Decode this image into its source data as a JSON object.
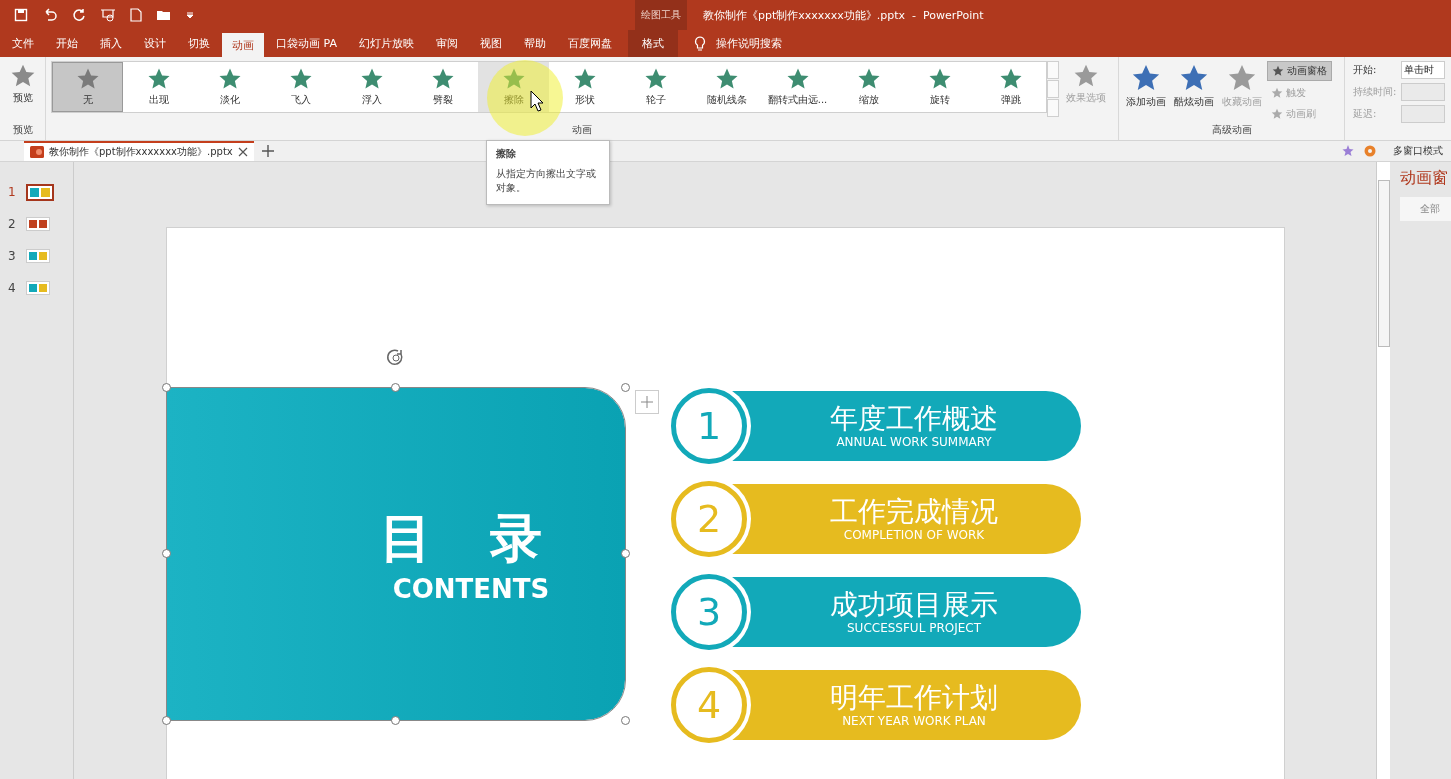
{
  "window": {
    "title": "教你制作《ppt制作xxxxxxx功能》.pptx  -  PowerPoint",
    "contextual_group": "绘图工具"
  },
  "ribbon_tabs": [
    {
      "label": "文件",
      "selected": false,
      "contextual": false
    },
    {
      "label": "开始",
      "selected": false,
      "contextual": false
    },
    {
      "label": "插入",
      "selected": false,
      "contextual": false
    },
    {
      "label": "设计",
      "selected": false,
      "contextual": false
    },
    {
      "label": "切换",
      "selected": false,
      "contextual": false
    },
    {
      "label": "动画",
      "selected": true,
      "contextual": false
    },
    {
      "label": "口袋动画 PA",
      "selected": false,
      "contextual": false
    },
    {
      "label": "幻灯片放映",
      "selected": false,
      "contextual": false
    },
    {
      "label": "审阅",
      "selected": false,
      "contextual": false
    },
    {
      "label": "视图",
      "selected": false,
      "contextual": false
    },
    {
      "label": "帮助",
      "selected": false,
      "contextual": false
    },
    {
      "label": "百度网盘",
      "selected": false,
      "contextual": false
    },
    {
      "label": "格式",
      "selected": false,
      "contextual": true
    }
  ],
  "tell_me": "操作说明搜索",
  "preview": {
    "label": "预览",
    "group": "预览"
  },
  "animations": [
    {
      "label": "无",
      "selected": true,
      "hovered": false
    },
    {
      "label": "出现",
      "selected": false,
      "hovered": false
    },
    {
      "label": "淡化",
      "selected": false,
      "hovered": false
    },
    {
      "label": "飞入",
      "selected": false,
      "hovered": false
    },
    {
      "label": "浮入",
      "selected": false,
      "hovered": false
    },
    {
      "label": "劈裂",
      "selected": false,
      "hovered": false
    },
    {
      "label": "擦除",
      "selected": false,
      "hovered": true
    },
    {
      "label": "形状",
      "selected": false,
      "hovered": false
    },
    {
      "label": "轮子",
      "selected": false,
      "hovered": false
    },
    {
      "label": "随机线条",
      "selected": false,
      "hovered": false
    },
    {
      "label": "翻转式由远...",
      "selected": false,
      "hovered": false
    },
    {
      "label": "缩放",
      "selected": false,
      "hovered": false
    },
    {
      "label": "旋转",
      "selected": false,
      "hovered": false
    },
    {
      "label": "弹跳",
      "selected": false,
      "hovered": false
    }
  ],
  "effect_options": {
    "label": "效果选项",
    "disabled": true
  },
  "animation_group": "动画",
  "advanced_large": [
    {
      "label": "添加动画",
      "disabled": false
    },
    {
      "label": "酷炫动画",
      "disabled": false
    },
    {
      "label": "收藏动画",
      "disabled": true
    }
  ],
  "advanced_small": [
    {
      "label": "动画窗格",
      "disabled": false,
      "pressed": true
    },
    {
      "label": "触发",
      "disabled": true,
      "pressed": false
    },
    {
      "label": "动画刷",
      "disabled": true,
      "pressed": false
    }
  ],
  "advanced_group": "高级动画",
  "timing": [
    {
      "label": "开始:",
      "value": "单击时",
      "disabled": false
    },
    {
      "label": "持续时间:",
      "disabled": true
    },
    {
      "label": "延迟:",
      "disabled": true
    }
  ],
  "doc_tab": "教你制作《ppt制作xxxxxxx功能》.pptx",
  "multi_window": "多窗口模式",
  "tooltip": {
    "title": "擦除",
    "text": "从指定方向擦出文字或对象。"
  },
  "thumbnails": [
    {
      "number": "1",
      "selected": true
    },
    {
      "number": "2",
      "selected": false
    },
    {
      "number": "3",
      "selected": false
    },
    {
      "number": "4",
      "selected": false
    }
  ],
  "slide": {
    "title": "目 录",
    "subtitle": "CONTENTS",
    "items": [
      {
        "number": "1",
        "title": "年度工作概述",
        "subtitle": "ANNUAL WORK SUMMARY",
        "color": "#12a9b9"
      },
      {
        "number": "2",
        "title": "工作完成情况",
        "subtitle": "COMPLETION OF WORK",
        "color": "#e6bb1f"
      },
      {
        "number": "3",
        "title": "成功项目展示",
        "subtitle": "SUCCESSFUL PROJECT",
        "color": "#12a9b9"
      },
      {
        "number": "4",
        "title": "明年工作计划",
        "subtitle": "NEXT YEAR WORK PLAN",
        "color": "#e6bb1f"
      }
    ]
  },
  "animation_pane": {
    "title": "动画窗",
    "button": "全部"
  }
}
